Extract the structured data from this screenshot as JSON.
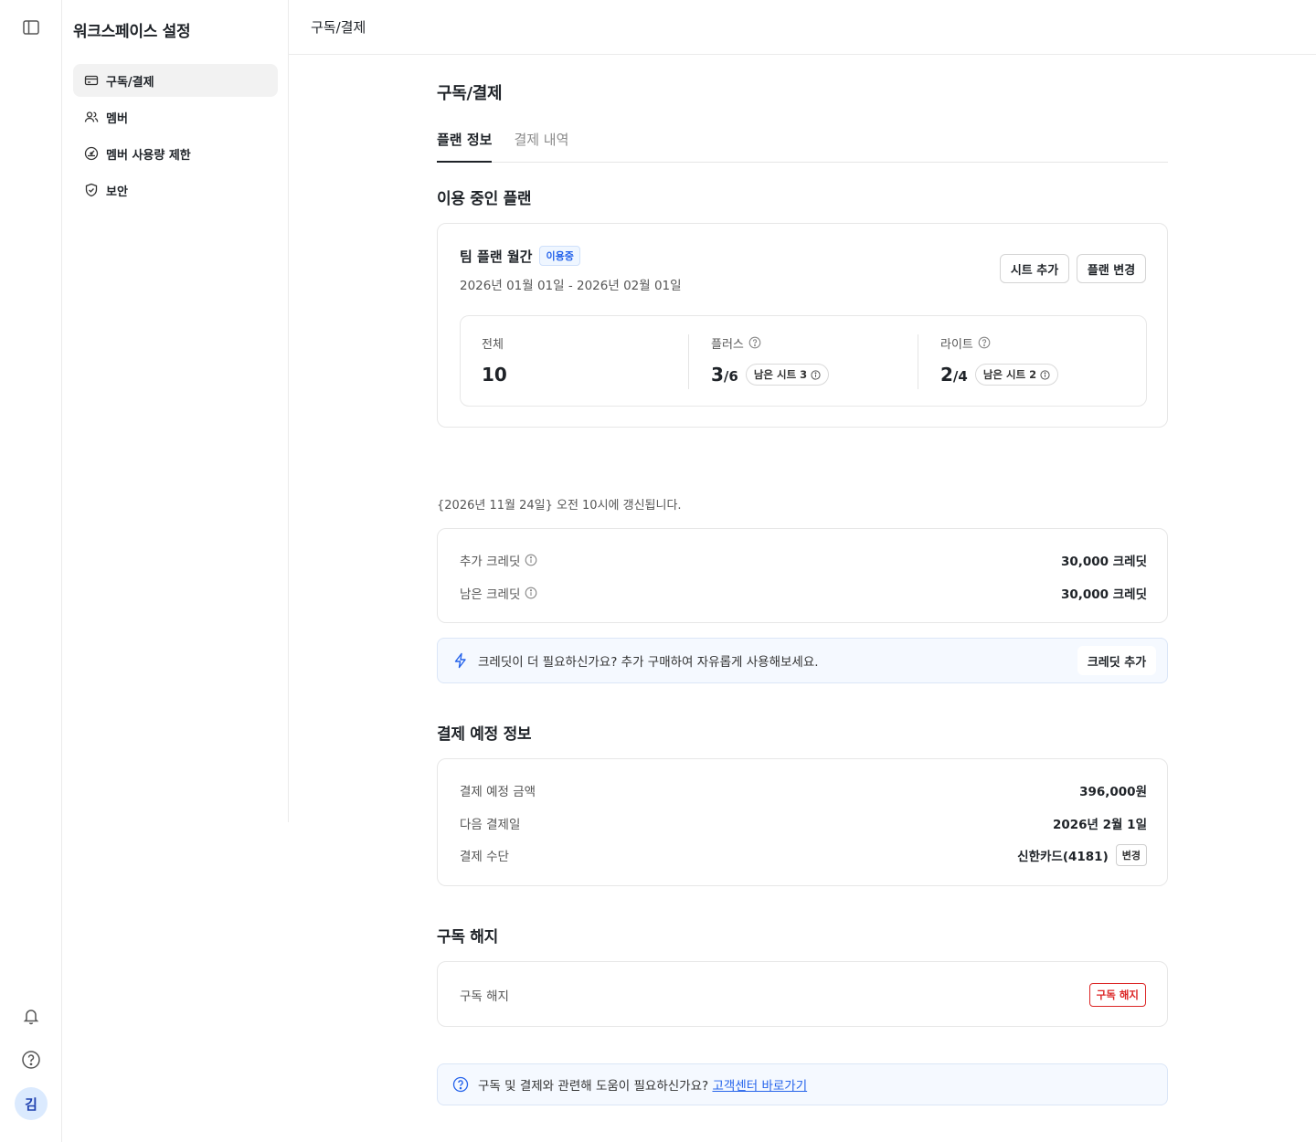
{
  "sidebar": {
    "title": "워크스페이스 설정",
    "items": [
      {
        "label": "구독/결제",
        "icon": "credit-card-icon",
        "active": true
      },
      {
        "label": "멤버",
        "icon": "users-icon",
        "active": false
      },
      {
        "label": "멤버 사용량 제한",
        "icon": "gauge-icon",
        "active": false
      },
      {
        "label": "보안",
        "icon": "shield-icon",
        "active": false
      }
    ]
  },
  "rail": {
    "avatar": "김",
    "icons": [
      "sidebar-toggle-icon",
      "bell-icon",
      "help-icon"
    ]
  },
  "topbar": {
    "breadcrumb": "구독/결제"
  },
  "page": {
    "title": "구독/결제",
    "tabs": [
      "플랜 정보",
      "결제 내역"
    ]
  },
  "plan": {
    "section_title": "이용 중인 플랜",
    "name": "팀 플랜 월간",
    "badge": "이용중",
    "period": "2026년 01월 01일 - 2026년 02월 01일",
    "add_seat": "시트 추가",
    "change_plan": "플랜 변경",
    "seats": {
      "total_label": "전체",
      "total_value": "10",
      "plus_label": "플러스",
      "plus_used": "3",
      "plus_total": "/6",
      "plus_remaining": "남은 시트 3",
      "lite_label": "라이트",
      "lite_used": "2",
      "lite_total": "/4",
      "lite_remaining": "남은 시트 2"
    }
  },
  "credits": {
    "refresh_text": "{2026년 11월 24일} 오전 10시에 갱신됩니다.",
    "extra_label": "추가 크레딧",
    "extra_value": "30,000 크레딧",
    "remaining_label": "남은 크레딧",
    "remaining_value": "30,000 크레딧",
    "promo_text": "크레딧이 더 필요하신가요? 추가 구매하여 자유롭게 사용해보세요.",
    "promo_button": "크레딧 추가"
  },
  "billing": {
    "section_title": "결제 예정 정보",
    "amount_label": "결제 예정 금액",
    "amount_value": "396,000원",
    "next_date_label": "다음 결제일",
    "next_date_value": "2026년 2월 1일",
    "method_label": "결제 수단",
    "method_value": "신한카드(4181)",
    "method_change": "변경"
  },
  "cancel": {
    "section_title": "구독 해지",
    "label": "구독 해지",
    "button": "구독 해지"
  },
  "help": {
    "text": "구독 및 결제와 관련해 도움이 필요하신가요?",
    "link": "고객센터 바로가기"
  },
  "colors": {
    "accent": "#2563eb",
    "danger": "#dc2626",
    "info_bg": "#f5f9ff",
    "active_nav_bg": "#f2f2f2"
  }
}
